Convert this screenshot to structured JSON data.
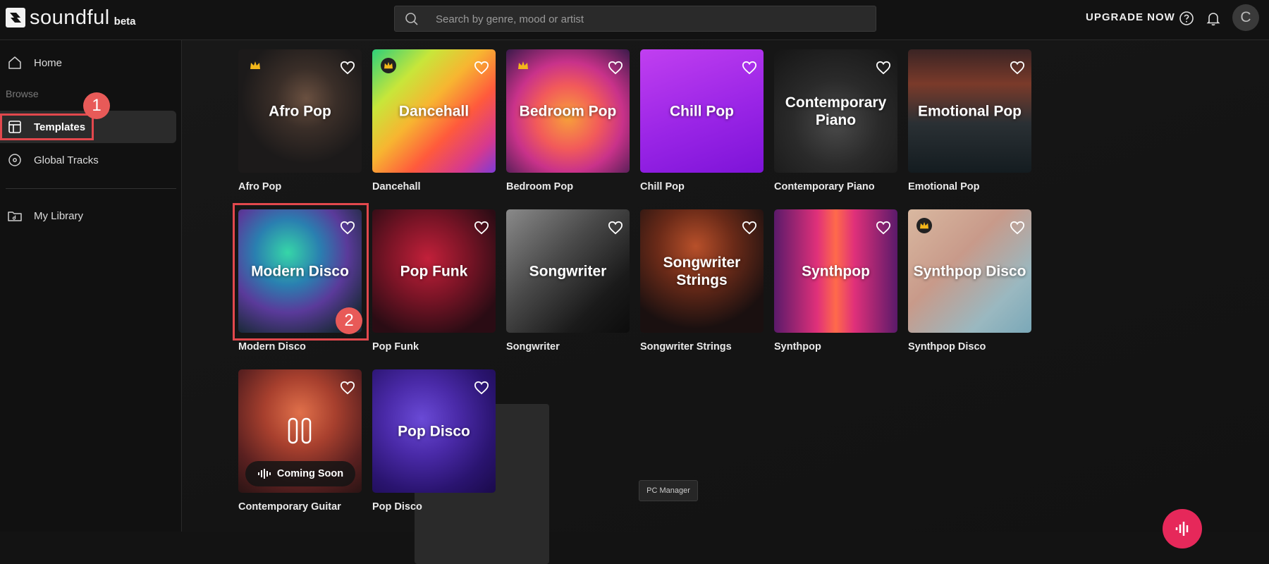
{
  "app": {
    "name": "soundful",
    "tag": "beta"
  },
  "header": {
    "search_placeholder": "Search by genre, mood or artist",
    "upgrade_label": "UPGRADE NOW",
    "avatar_initial": "C"
  },
  "sidebar": {
    "home": "Home",
    "browse_heading": "Browse",
    "templates": "Templates",
    "global_tracks": "Global Tracks",
    "my_library": "My Library"
  },
  "annotations": {
    "badge1": "1",
    "badge2": "2"
  },
  "templates": [
    {
      "title": "Afro Pop",
      "name": "Afro Pop",
      "premium": true
    },
    {
      "title": "Dancehall",
      "name": "Dancehall",
      "premium": true
    },
    {
      "title": "Bedroom Pop",
      "name": "Bedroom Pop",
      "premium": true
    },
    {
      "title": "Chill Pop",
      "name": "Chill Pop",
      "premium": false
    },
    {
      "title": "Contemporary Piano",
      "name": "Contemporary Piano",
      "premium": false
    },
    {
      "title": "Emotional Pop",
      "name": "Emotional Pop",
      "premium": false
    },
    {
      "title": "Modern Disco",
      "name": "Modern Disco",
      "premium": false
    },
    {
      "title": "Pop Funk",
      "name": "Pop Funk",
      "premium": false
    },
    {
      "title": "Songwriter",
      "name": "Songwriter",
      "premium": false
    },
    {
      "title": "Songwriter Strings",
      "name": "Songwriter Strings",
      "premium": false
    },
    {
      "title": "Synthpop",
      "name": "Synthpop",
      "premium": false
    },
    {
      "title": "Synthpop Disco",
      "name": "Synthpop Disco",
      "premium": true
    },
    {
      "title": "",
      "name": "Contemporary Guitar",
      "premium": false,
      "status": "Coming Soon"
    },
    {
      "title": "Pop Disco",
      "name": "Pop Disco",
      "premium": false
    }
  ],
  "tooltip": "PC Manager",
  "colors": {
    "accent": "#e6285a",
    "highlight": "#e2484d",
    "crown": "#f3b71b"
  }
}
